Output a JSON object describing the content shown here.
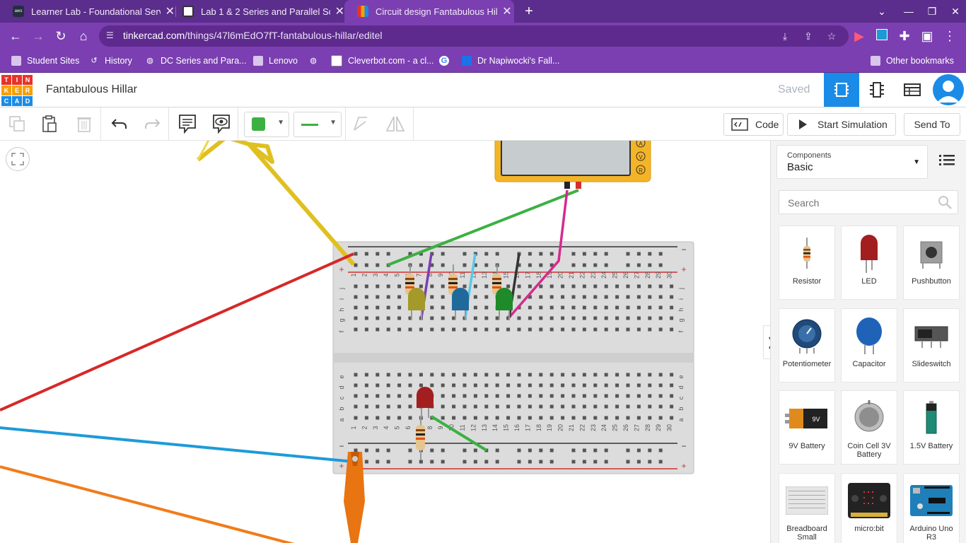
{
  "browser": {
    "tabs": [
      {
        "title": "Learner Lab - Foundational Servi",
        "favicon": "aws-icon"
      },
      {
        "title": "Lab 1 & 2 Series and Parallel Sci",
        "favicon": "classroom-icon"
      },
      {
        "title": "Circuit design Fantabulous Hilla",
        "favicon": "tinkercad-icon",
        "active": true
      }
    ],
    "url_domain": "tinkercad.com",
    "url_path": "/things/47l6mEdO7fT-fantabulous-hillar/editel",
    "bookmarks": [
      {
        "label": "Student Sites",
        "icon": "folder-icon"
      },
      {
        "label": "History",
        "icon": "history-icon"
      },
      {
        "label": "DC Series and Para...",
        "icon": "globe-icon"
      },
      {
        "label": "Lenovo",
        "icon": "folder-icon"
      },
      {
        "label": "",
        "icon": "globe-icon"
      },
      {
        "label": "Cleverbot.com - a cl...",
        "icon": "cleverbot-icon"
      },
      {
        "label": "",
        "icon": "google-icon"
      },
      {
        "label": "Dr Napiwocki's Fall...",
        "icon": "classroom-icon"
      }
    ],
    "other_bookmarks": "Other bookmarks"
  },
  "header": {
    "design_title": "Fantabulous Hillar",
    "save_status": "Saved",
    "logo_letters": [
      "T",
      "I",
      "N",
      "K",
      "E",
      "R",
      "C",
      "A",
      "D"
    ]
  },
  "toolbar": {
    "code_label": "Code",
    "start_sim_label": "Start Simulation",
    "send_to_label": "Send To",
    "selected_color": "#3cb043"
  },
  "panel": {
    "components_caption": "Components",
    "components_value": "Basic",
    "search_placeholder": "Search",
    "components": [
      {
        "label": "Resistor"
      },
      {
        "label": "LED"
      },
      {
        "label": "Pushbutton"
      },
      {
        "label": "Potentiometer"
      },
      {
        "label": "Capacitor"
      },
      {
        "label": "Slideswitch"
      },
      {
        "label": "9V Battery"
      },
      {
        "label": "Coin Cell 3V Battery"
      },
      {
        "label": "1.5V Battery"
      },
      {
        "label": "Breadboard Small"
      },
      {
        "label": "micro:bit"
      },
      {
        "label": "Arduino Uno R3"
      }
    ]
  },
  "breadboard": {
    "column_numbers": [
      "1",
      "2",
      "3",
      "4",
      "5",
      "6",
      "7",
      "8",
      "9",
      "10",
      "11",
      "12",
      "13",
      "14",
      "15",
      "16",
      "17",
      "18",
      "19",
      "20",
      "21",
      "22",
      "23",
      "24",
      "25",
      "26",
      "27",
      "28",
      "29",
      "30"
    ],
    "upper_rows": [
      "j",
      "i",
      "h",
      "g",
      "f"
    ],
    "lower_rows": [
      "e",
      "d",
      "c",
      "b",
      "a"
    ],
    "rail_plus": "+",
    "rail_minus": "−"
  },
  "multimeter": {
    "modes": [
      "A",
      "V",
      "R"
    ]
  }
}
